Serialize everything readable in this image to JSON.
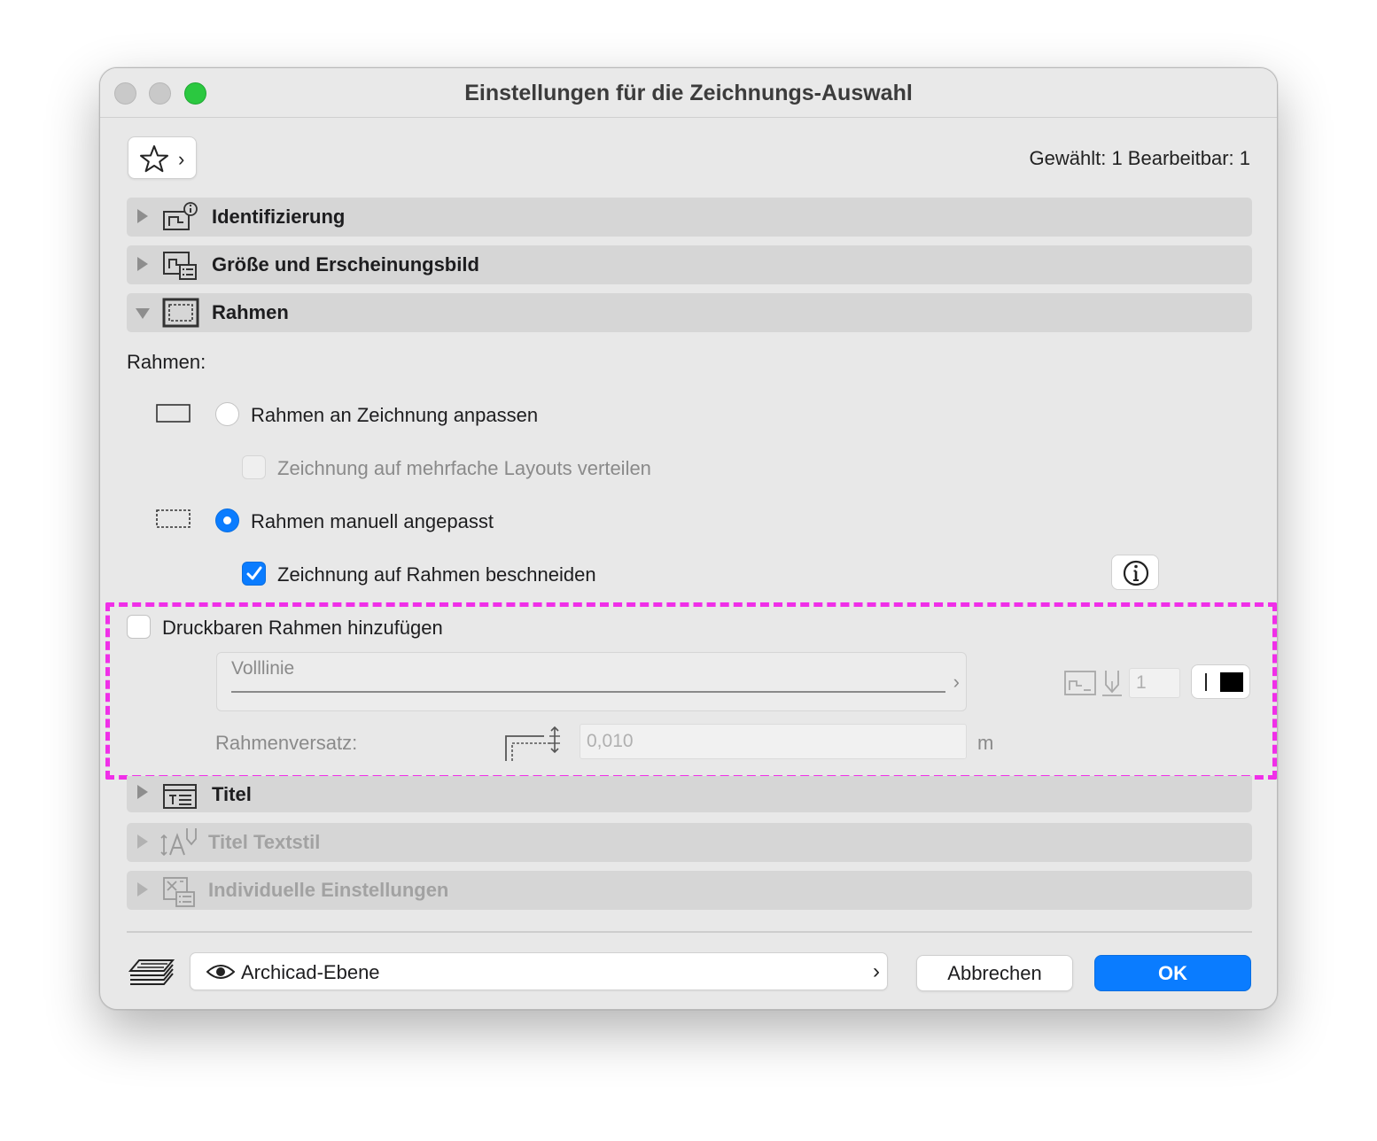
{
  "window": {
    "title": "Einstellungen für die Zeichnungs-Auswahl"
  },
  "toolbar": {
    "favorites_icon": "star-icon",
    "selection_info": "Gewählt: 1 Bearbeitbar: 1"
  },
  "sections": [
    {
      "label": "Identifizierung",
      "icon": "identification-icon",
      "expanded": false,
      "enabled": true
    },
    {
      "label": "Größe und Erscheinungsbild",
      "icon": "size-appearance-icon",
      "expanded": false,
      "enabled": true
    },
    {
      "label": "Rahmen",
      "icon": "frame-icon",
      "expanded": true,
      "enabled": true
    },
    {
      "label": "Titel",
      "icon": "title-icon",
      "expanded": false,
      "enabled": true
    },
    {
      "label": "Titel Textstil",
      "icon": "text-style-icon",
      "expanded": false,
      "enabled": false
    },
    {
      "label": "Individuelle Einstellungen",
      "icon": "custom-settings-icon",
      "expanded": false,
      "enabled": false
    }
  ],
  "frame": {
    "heading": "Rahmen:",
    "option_fit": "Rahmen an Zeichnung anpassen",
    "option_fit_selected": false,
    "option_distribute": "Zeichnung auf mehrfache Layouts verteilen",
    "option_distribute_checked": false,
    "option_manual": "Rahmen manuell angepasst",
    "option_manual_selected": true,
    "option_crop": "Zeichnung auf Rahmen beschneiden",
    "option_crop_checked": true,
    "printable_frame": "Druckbaren Rahmen hinzufügen",
    "printable_frame_checked": false,
    "line_type": "Volllinie",
    "pen_number": "1",
    "pen_color": "#000000",
    "offset_label": "Rahmenversatz:",
    "offset_value": "0,010",
    "offset_unit": "m"
  },
  "footer": {
    "layer": "Archicad-Ebene",
    "cancel": "Abbrechen",
    "ok": "OK"
  },
  "colors": {
    "accent": "#0a7cff",
    "highlight": "#f02fe8"
  }
}
